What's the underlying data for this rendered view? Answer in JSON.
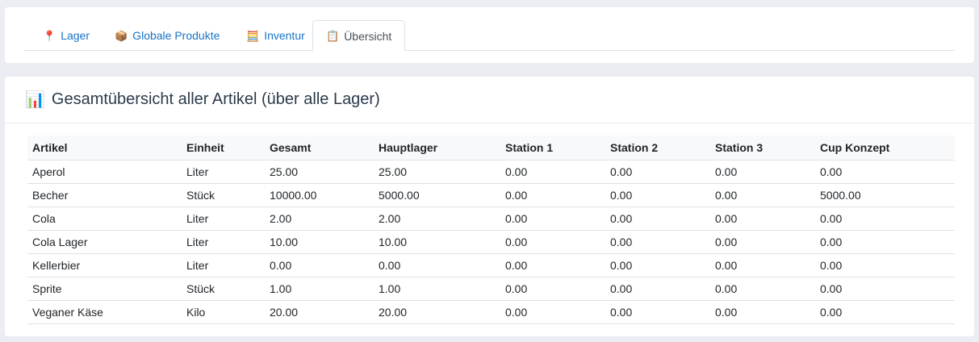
{
  "tabs": [
    {
      "label": "Lager",
      "icon": "📍",
      "active": false
    },
    {
      "label": "Globale Produkte",
      "icon": "📦",
      "active": false
    },
    {
      "label": "Inventur",
      "icon": "🧮",
      "active": false
    },
    {
      "label": "Übersicht",
      "icon": "📋",
      "active": true
    }
  ],
  "panel": {
    "icon": "📊",
    "title": "Gesamtübersicht aller Artikel (über alle Lager)"
  },
  "table": {
    "headers": [
      "Artikel",
      "Einheit",
      "Gesamt",
      "Hauptlager",
      "Station 1",
      "Station 2",
      "Station 3",
      "Cup Konzept"
    ],
    "rows": [
      [
        "Aperol",
        "Liter",
        "25.00",
        "25.00",
        "0.00",
        "0.00",
        "0.00",
        "0.00"
      ],
      [
        "Becher",
        "Stück",
        "10000.00",
        "5000.00",
        "0.00",
        "0.00",
        "0.00",
        "5000.00"
      ],
      [
        "Cola",
        "Liter",
        "2.00",
        "2.00",
        "0.00",
        "0.00",
        "0.00",
        "0.00"
      ],
      [
        "Cola Lager",
        "Liter",
        "10.00",
        "10.00",
        "0.00",
        "0.00",
        "0.00",
        "0.00"
      ],
      [
        "Kellerbier",
        "Liter",
        "0.00",
        "0.00",
        "0.00",
        "0.00",
        "0.00",
        "0.00"
      ],
      [
        "Sprite",
        "Stück",
        "1.00",
        "1.00",
        "0.00",
        "0.00",
        "0.00",
        "0.00"
      ],
      [
        "Veganer Käse",
        "Kilo",
        "20.00",
        "20.00",
        "0.00",
        "0.00",
        "0.00",
        "0.00"
      ]
    ]
  }
}
